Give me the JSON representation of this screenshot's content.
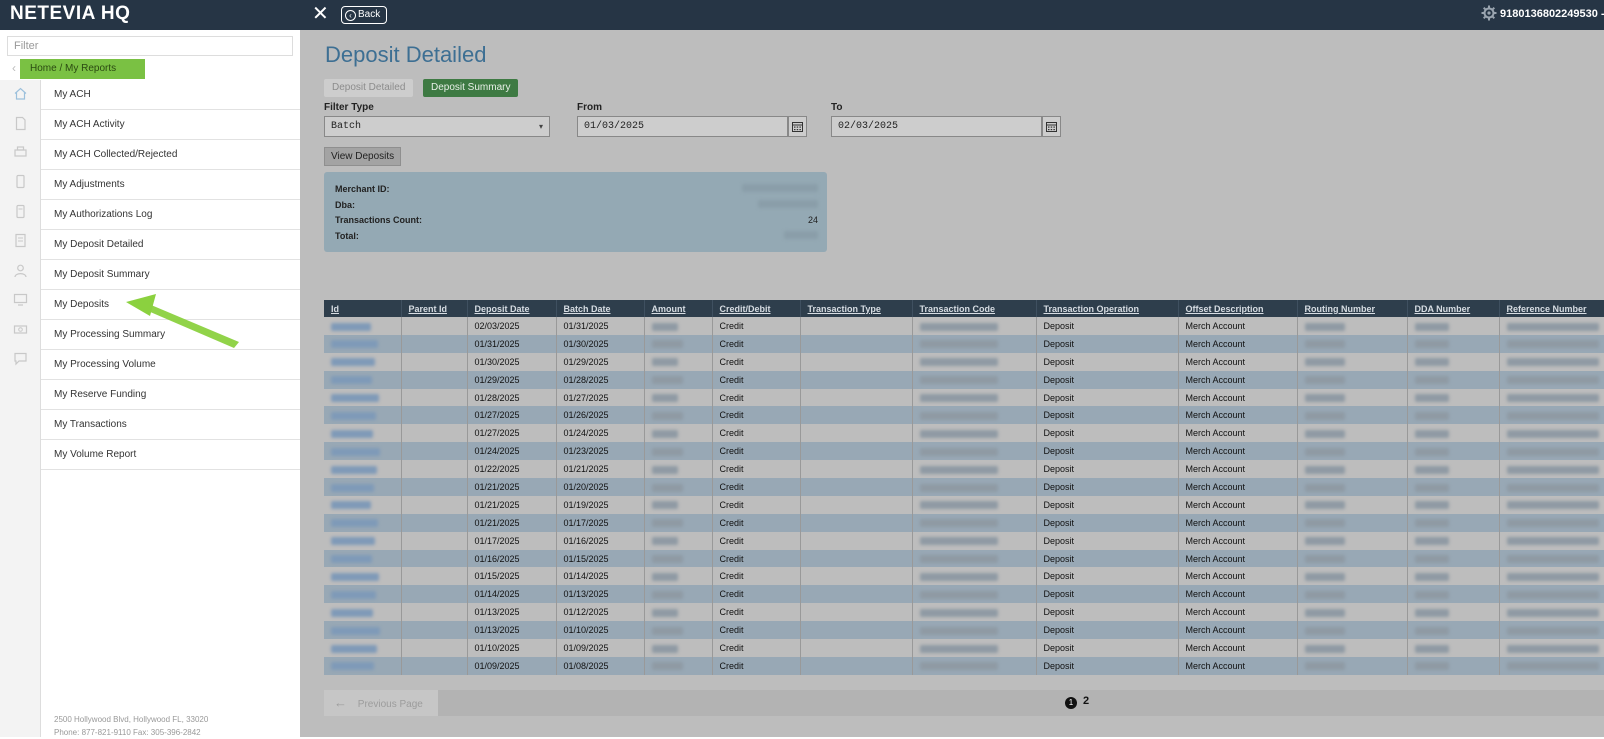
{
  "app": {
    "brand": "NETEVIA HQ",
    "back_label": "Back",
    "account_number": "9180136802249530 -"
  },
  "sidebar": {
    "filter_placeholder": "Filter",
    "breadcrumb": "Home / My Reports",
    "items": [
      {
        "label": "My ACH"
      },
      {
        "label": "My ACH Activity"
      },
      {
        "label": "My ACH Collected/Rejected"
      },
      {
        "label": "My Adjustments"
      },
      {
        "label": "My Authorizations Log"
      },
      {
        "label": "My Deposit Detailed"
      },
      {
        "label": "My Deposit Summary"
      },
      {
        "label": "My Deposits"
      },
      {
        "label": "My Processing Summary"
      },
      {
        "label": "My Processing Volume"
      },
      {
        "label": "My Reserve Funding"
      },
      {
        "label": "My Transactions"
      },
      {
        "label": "My Volume Report"
      }
    ],
    "footer_address": "2500 Hollywood Blvd, Hollywood FL, 33020",
    "footer_phone": "Phone: 877-821-9110 Fax: 305-396-2842"
  },
  "main": {
    "title": "Deposit Detailed",
    "tabs": [
      {
        "label": "Deposit Detailed"
      },
      {
        "label": "Deposit Summary"
      }
    ],
    "filter_type_label": "Filter Type",
    "filter_type_value": "Batch",
    "from_label": "From",
    "from_value": "01/03/2025",
    "to_label": "To",
    "to_value": "02/03/2025",
    "view_button": "View Deposits",
    "summary": {
      "merchant_id_label": "Merchant ID:",
      "dba_label": "Dba:",
      "tx_count_label": "Transactions Count:",
      "tx_count_value": "24",
      "total_label": "Total:"
    },
    "table": {
      "columns": [
        "Id",
        "Parent Id",
        "Deposit Date",
        "Batch Date",
        "Amount",
        "Credit/Debit",
        "Transaction Type",
        "Transaction Code",
        "Transaction Operation",
        "Offset Description",
        "Routing Number",
        "DDA Number",
        "Reference Number"
      ],
      "rows": [
        {
          "deposit_date": "02/03/2025",
          "batch_date": "01/31/2025",
          "credit_debit": "Credit",
          "operation": "Deposit",
          "offset": "Merch Account"
        },
        {
          "deposit_date": "01/31/2025",
          "batch_date": "01/30/2025",
          "credit_debit": "Credit",
          "operation": "Deposit",
          "offset": "Merch Account"
        },
        {
          "deposit_date": "01/30/2025",
          "batch_date": "01/29/2025",
          "credit_debit": "Credit",
          "operation": "Deposit",
          "offset": "Merch Account"
        },
        {
          "deposit_date": "01/29/2025",
          "batch_date": "01/28/2025",
          "credit_debit": "Credit",
          "operation": "Deposit",
          "offset": "Merch Account"
        },
        {
          "deposit_date": "01/28/2025",
          "batch_date": "01/27/2025",
          "credit_debit": "Credit",
          "operation": "Deposit",
          "offset": "Merch Account"
        },
        {
          "deposit_date": "01/27/2025",
          "batch_date": "01/26/2025",
          "credit_debit": "Credit",
          "operation": "Deposit",
          "offset": "Merch Account"
        },
        {
          "deposit_date": "01/27/2025",
          "batch_date": "01/24/2025",
          "credit_debit": "Credit",
          "operation": "Deposit",
          "offset": "Merch Account"
        },
        {
          "deposit_date": "01/24/2025",
          "batch_date": "01/23/2025",
          "credit_debit": "Credit",
          "operation": "Deposit",
          "offset": "Merch Account"
        },
        {
          "deposit_date": "01/22/2025",
          "batch_date": "01/21/2025",
          "credit_debit": "Credit",
          "operation": "Deposit",
          "offset": "Merch Account"
        },
        {
          "deposit_date": "01/21/2025",
          "batch_date": "01/20/2025",
          "credit_debit": "Credit",
          "operation": "Deposit",
          "offset": "Merch Account"
        },
        {
          "deposit_date": "01/21/2025",
          "batch_date": "01/19/2025",
          "credit_debit": "Credit",
          "operation": "Deposit",
          "offset": "Merch Account"
        },
        {
          "deposit_date": "01/21/2025",
          "batch_date": "01/17/2025",
          "credit_debit": "Credit",
          "operation": "Deposit",
          "offset": "Merch Account"
        },
        {
          "deposit_date": "01/17/2025",
          "batch_date": "01/16/2025",
          "credit_debit": "Credit",
          "operation": "Deposit",
          "offset": "Merch Account"
        },
        {
          "deposit_date": "01/16/2025",
          "batch_date": "01/15/2025",
          "credit_debit": "Credit",
          "operation": "Deposit",
          "offset": "Merch Account"
        },
        {
          "deposit_date": "01/15/2025",
          "batch_date": "01/14/2025",
          "credit_debit": "Credit",
          "operation": "Deposit",
          "offset": "Merch Account"
        },
        {
          "deposit_date": "01/14/2025",
          "batch_date": "01/13/2025",
          "credit_debit": "Credit",
          "operation": "Deposit",
          "offset": "Merch Account"
        },
        {
          "deposit_date": "01/13/2025",
          "batch_date": "01/12/2025",
          "credit_debit": "Credit",
          "operation": "Deposit",
          "offset": "Merch Account"
        },
        {
          "deposit_date": "01/13/2025",
          "batch_date": "01/10/2025",
          "credit_debit": "Credit",
          "operation": "Deposit",
          "offset": "Merch Account"
        },
        {
          "deposit_date": "01/10/2025",
          "batch_date": "01/09/2025",
          "credit_debit": "Credit",
          "operation": "Deposit",
          "offset": "Merch Account"
        },
        {
          "deposit_date": "01/09/2025",
          "batch_date": "01/08/2025",
          "credit_debit": "Credit",
          "operation": "Deposit",
          "offset": "Merch Account"
        }
      ]
    },
    "pager": {
      "prev_label": "Previous Page",
      "current_page": "1",
      "next_page": "2"
    }
  },
  "colors": {
    "topbar": "#263545",
    "breadcrumb_highlight": "#7ac143",
    "title_blue": "#3d6f93",
    "summary_tab_green": "#3e7a43",
    "annotation_arrow": "#8bd13f"
  }
}
